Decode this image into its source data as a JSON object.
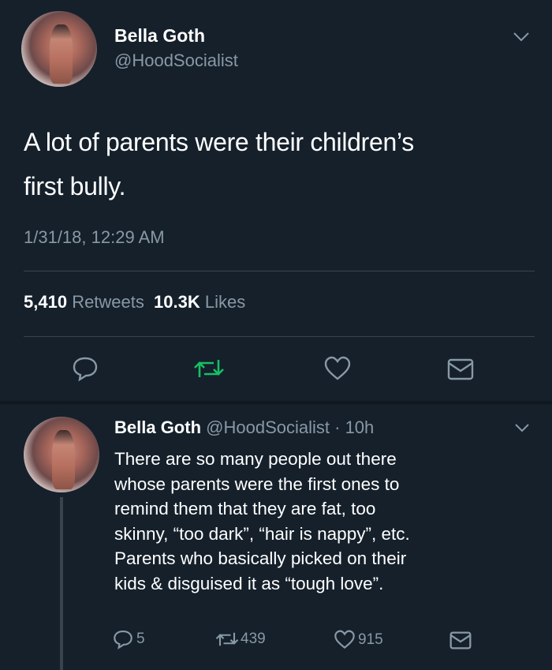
{
  "main_tweet": {
    "display_name": "Bella Goth",
    "handle": "@HoodSocialist",
    "text_line1": "A lot of parents were their children’s",
    "text_line2": "first bully.",
    "timestamp": "1/31/18, 12:29 AM",
    "retweets_count": "5,410",
    "retweets_label": "Retweets",
    "likes_count": "10.3K",
    "likes_label": "Likes"
  },
  "reply_tweet": {
    "display_name": "Bella Goth",
    "handle": "@HoodSocialist",
    "time": "· 10h",
    "lines": [
      "There are so many people out there",
      "whose parents were the first ones to",
      "remind them that they are fat, too",
      "skinny, “too dark”, “hair is nappy”, etc.",
      "Parents who basically picked on their",
      "kids & disguised it as “tough love”."
    ],
    "reply_count": "5",
    "retweet_count": "439",
    "like_count": "915"
  },
  "colors": {
    "background": "#15202b",
    "muted": "#8899a6",
    "retweet_green": "#17bf63",
    "divider": "#38444d"
  },
  "icons": [
    "chevron-down-icon",
    "reply-icon",
    "retweet-icon",
    "heart-icon",
    "message-icon"
  ]
}
